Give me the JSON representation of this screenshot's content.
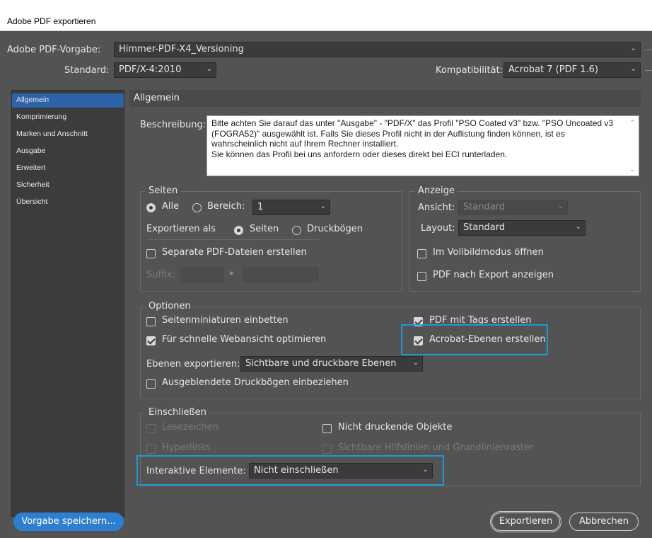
{
  "window": {
    "title": "Adobe PDF exportieren"
  },
  "header": {
    "preset_label": "Adobe PDF-Vorgabe:",
    "preset_value": "Himmer-PDF-X4_Versioning",
    "standard_label": "Standard:",
    "standard_value": "PDF/X-4:2010",
    "compat_label": "Kompatibilität:",
    "compat_value": "Acrobat 7 (PDF 1.6)"
  },
  "sidebar": {
    "items": [
      {
        "label": "Allgemein",
        "active": true
      },
      {
        "label": "Komprimierung"
      },
      {
        "label": "Marken und Anschnitt"
      },
      {
        "label": "Ausgabe"
      },
      {
        "label": "Erweitert"
      },
      {
        "label": "Sicherheit"
      },
      {
        "label": "Übersicht"
      }
    ]
  },
  "content": {
    "title": "Allgemein",
    "description_label": "Beschreibung:",
    "description_text": "Bitte achten Sie darauf das unter \"Ausgabe\" - \"PDF/X\" das Profil \"PSO Coated v3\" bzw. \"PSO Uncoated v3 (FOGRA52)\" ausgewählt ist. Falls Sie dieses Profil nicht in der Auflistung finden können, ist es wahrscheinlich nicht auf Ihrem Rechner installiert.\nSie können das Profil bei uns anfordern oder dieses direkt bei ECI runterladen."
  },
  "pages": {
    "legend": "Seiten",
    "all_label": "Alle",
    "all_selected": true,
    "range_label": "Bereich:",
    "range_value": "1",
    "export_as_label": "Exportieren als",
    "pages_label": "Seiten",
    "pages_selected": true,
    "spreads_label": "Druckbögen",
    "separate_label": "Separate PDF-Dateien erstellen",
    "separate_checked": false,
    "suffix_label": "Suffix:"
  },
  "view": {
    "legend": "Anzeige",
    "view_label": "Ansicht:",
    "view_value": "Standard",
    "layout_label": "Layout:",
    "layout_value": "Standard",
    "fullscreen_label": "Im Vollbildmodus öffnen",
    "fullscreen_checked": false,
    "show_after_label": "PDF nach Export anzeigen",
    "show_after_checked": false
  },
  "options": {
    "legend": "Optionen",
    "thumbnails_label": "Seitenminiaturen einbetten",
    "thumbnails_checked": false,
    "fastweb_label": "Für schnelle Webansicht optimieren",
    "fastweb_checked": true,
    "tagged_label": "PDF mit Tags erstellen",
    "tagged_checked": true,
    "layers_label": "Acrobat-Ebenen erstellen",
    "layers_checked": true,
    "export_layers_label": "Ebenen exportieren:",
    "export_layers_value": "Sichtbare und druckbare Ebenen",
    "hidden_spreads_label": "Ausgeblendete Druckbögen einbeziehen",
    "hidden_spreads_checked": false
  },
  "include": {
    "legend": "Einschließen",
    "bookmarks_label": "Lesezeichen",
    "hyperlinks_label": "Hyperlinks",
    "nonprinting_label": "Nicht druckende Objekte",
    "nonprinting_checked": false,
    "guides_label": "Sichtbare Hilfslinien und Grundlinienraster",
    "interactive_label": "Interaktive Elemente:",
    "interactive_value": "Nicht einschließen"
  },
  "footer": {
    "save_preset_label": "Vorgabe speichern...",
    "export_label": "Exportieren",
    "cancel_label": "Abbrechen"
  },
  "colors": {
    "background": "#535353",
    "accent": "#2e7fd0",
    "highlight": "#1a9ad6",
    "sidebar_active": "#2d63a8"
  }
}
